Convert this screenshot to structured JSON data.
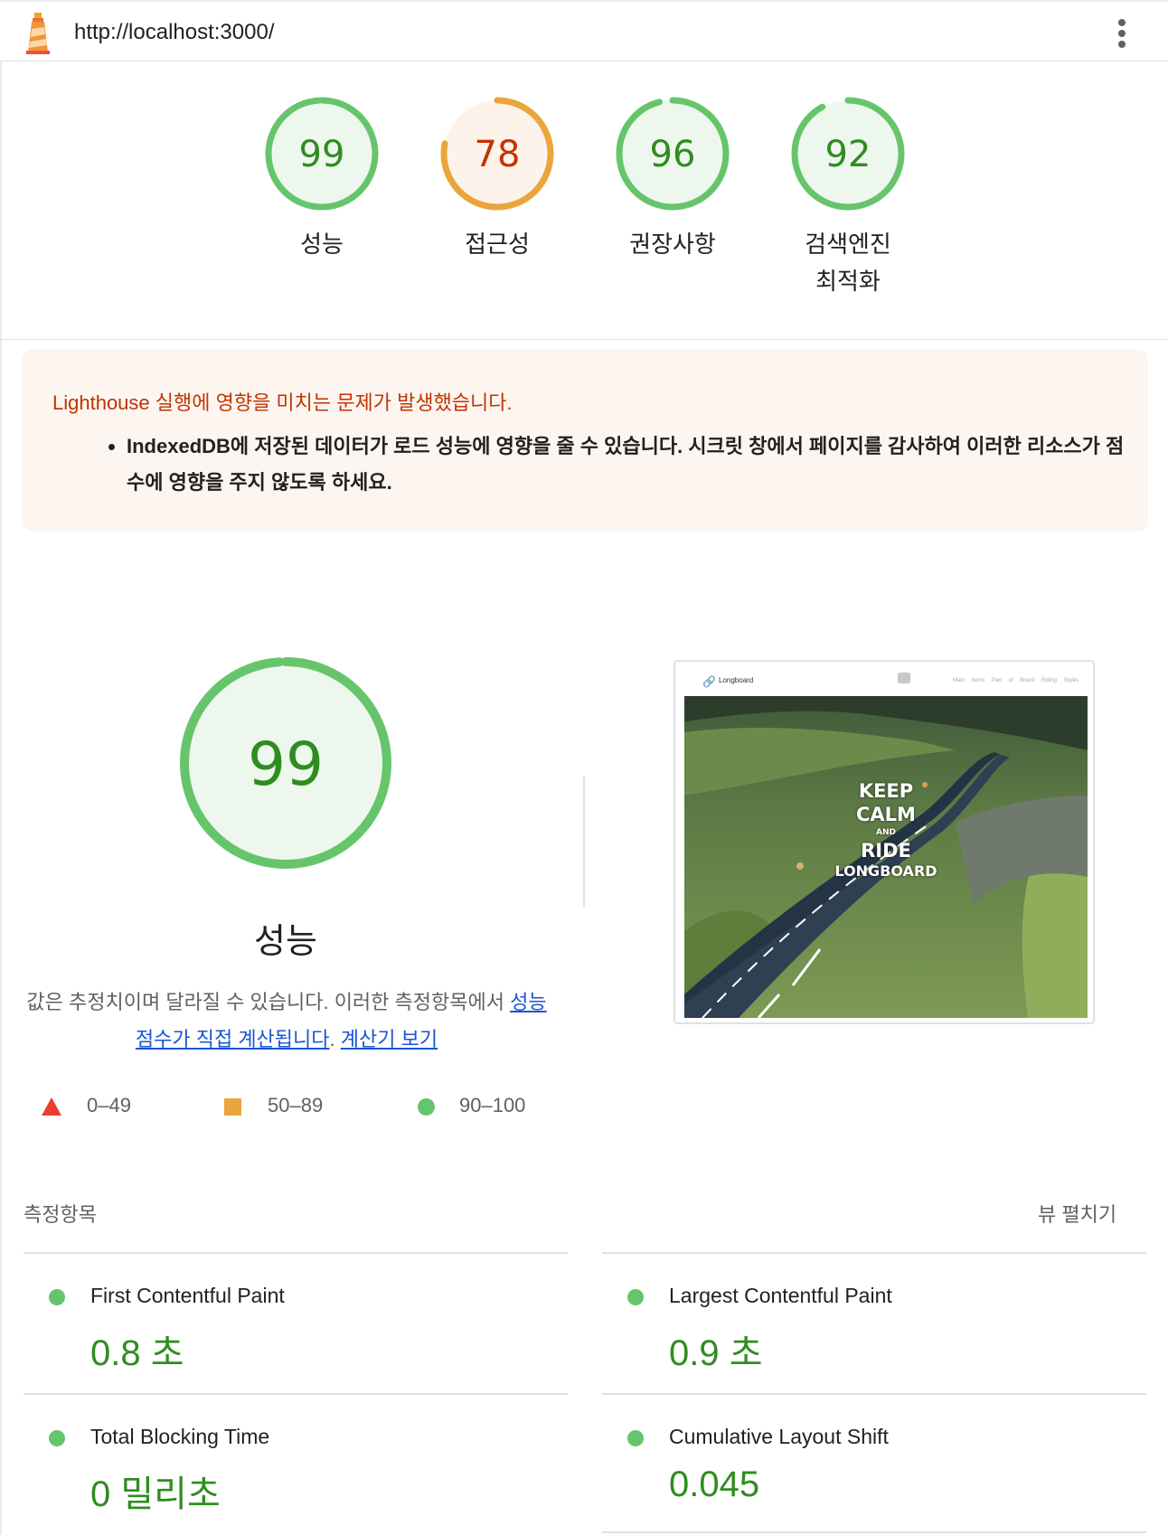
{
  "header": {
    "url": "http://localhost:3000/",
    "logo_icon": "lighthouse-icon",
    "menu_icon": "more-vert-icon"
  },
  "categories": [
    {
      "score": "99",
      "label": "성능",
      "status": "pass"
    },
    {
      "score": "78",
      "label": "접근성",
      "status": "average"
    },
    {
      "score": "96",
      "label": "권장사항",
      "status": "pass"
    },
    {
      "score": "92",
      "label": "검색엔진 최적화",
      "status": "pass"
    }
  ],
  "warning": {
    "title": "Lighthouse 실행에 영향을 미치는 문제가 발생했습니다.",
    "items": [
      "IndexedDB에 저장된 데이터가 로드 성능에 영향을 줄 수 있습니다. 시크릿 창에서 페이지를 감사하여 이러한 리소스가 점수에 영향을 주지 않도록 하세요."
    ]
  },
  "performance": {
    "score": "99",
    "title": "성능",
    "desc_prefix": "값은 추정치이며 달라질 수 있습니다. 이러한 측정항목에서 ",
    "desc_link1": "성능 점수가 직접 계산됩니다",
    "desc_mid": ". ",
    "desc_link2": "계산기 보기"
  },
  "screenshot": {
    "brand": "Longboard",
    "nav": "Main Items Part of Board Riding Styles",
    "overlay": [
      "KEEP",
      "CALM",
      "AND",
      "RIDE",
      "LONGBOARD"
    ]
  },
  "legend": [
    {
      "shape": "triangle",
      "range": "0–49",
      "color": "#e8402c"
    },
    {
      "shape": "square",
      "range": "50–89",
      "color": "#eaa63a"
    },
    {
      "shape": "circle",
      "range": "90–100",
      "color": "#66c56b"
    }
  ],
  "metrics": {
    "heading": "측정항목",
    "expand_label": "뷰 펼치기",
    "items": [
      {
        "name": "First Contentful Paint",
        "value": "0.8 초"
      },
      {
        "name": "Largest Contentful Paint",
        "value": "0.9 초"
      },
      {
        "name": "Total Blocking Time",
        "value": "0 밀리초"
      },
      {
        "name": "Cumulative Layout Shift",
        "value": "0.045"
      }
    ]
  },
  "colors": {
    "pass": "#66c56b",
    "pass_text": "#2f8d1f",
    "pass_bg": "#eef7ee",
    "average": "#eaa63a",
    "average_text": "#c33300",
    "average_bg": "#fdf3ea",
    "link": "#1a55d3"
  }
}
